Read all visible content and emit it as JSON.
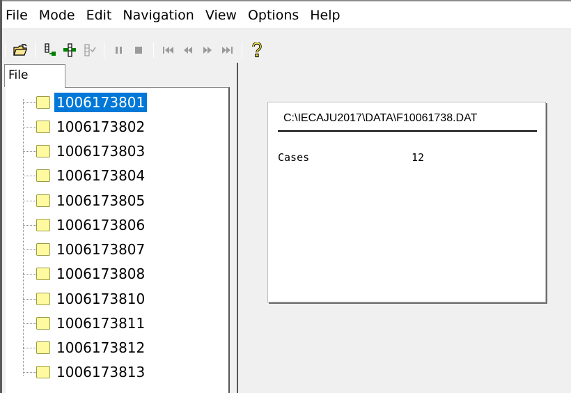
{
  "menu": [
    {
      "label": "File"
    },
    {
      "label": "Mode"
    },
    {
      "label": "Edit"
    },
    {
      "label": "Navigation"
    },
    {
      "label": "View"
    },
    {
      "label": "Options"
    },
    {
      "label": "Help"
    }
  ],
  "toolbar": {
    "buttons": [
      "open-folder-icon",
      "add-node-icon",
      "insert-node-icon",
      "edit-disabled-icon",
      "pause-icon",
      "stop-icon",
      "first-record-icon",
      "previous-record-icon",
      "next-record-icon",
      "last-record-icon",
      "help-icon"
    ]
  },
  "left_pane": {
    "tab_label": "File",
    "items": [
      {
        "label": "1006173801",
        "selected": true
      },
      {
        "label": "1006173802"
      },
      {
        "label": "1006173803"
      },
      {
        "label": "1006173804"
      },
      {
        "label": "1006173805"
      },
      {
        "label": "1006173806"
      },
      {
        "label": "1006173807"
      },
      {
        "label": "1006173808"
      },
      {
        "label": "1006173810"
      },
      {
        "label": "1006173811"
      },
      {
        "label": "1006173812"
      },
      {
        "label": "1006173813"
      }
    ]
  },
  "info_panel": {
    "path": "C:\\IECAJU2017\\DATA\\F10061738.DAT",
    "cases_label": "Cases",
    "cases_value": "12"
  },
  "colors": {
    "selection": "#0078d7",
    "node_fill": "#fffaa0",
    "background": "#f0f0f0"
  }
}
